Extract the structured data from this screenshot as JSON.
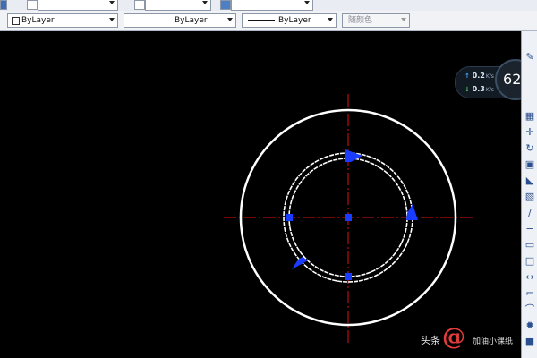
{
  "toolbar": {
    "top_row": {
      "combo_count": 4
    },
    "color_combo": {
      "value": "ByLayer"
    },
    "linetype_combo": {
      "value": "ByLayer"
    },
    "lineweight_combo": {
      "value": "ByLayer"
    },
    "plotstyle_combo": {
      "value": "随颜色"
    }
  },
  "network_widget": {
    "upload": {
      "value": "0.2",
      "unit": "K/s"
    },
    "download": {
      "value": "0.3",
      "unit": "K/s"
    },
    "gauge": {
      "value": "62",
      "unit": "%"
    }
  },
  "watermark": {
    "prefix": "头条",
    "main": "@",
    "sub": "加油小课纸"
  },
  "colors": {
    "canvas_bg": "#000000",
    "geometry": "#ffffff",
    "centerline": "#e01010",
    "grip": "#1a3cff"
  },
  "icons": [
    "pencil-icon",
    "move-icon",
    "rotate-icon",
    "grid-icon",
    "scale-icon",
    "mirror-icon",
    "line-icon",
    "rectangle-icon",
    "arc-icon",
    "fillet-icon",
    "explode-icon"
  ]
}
